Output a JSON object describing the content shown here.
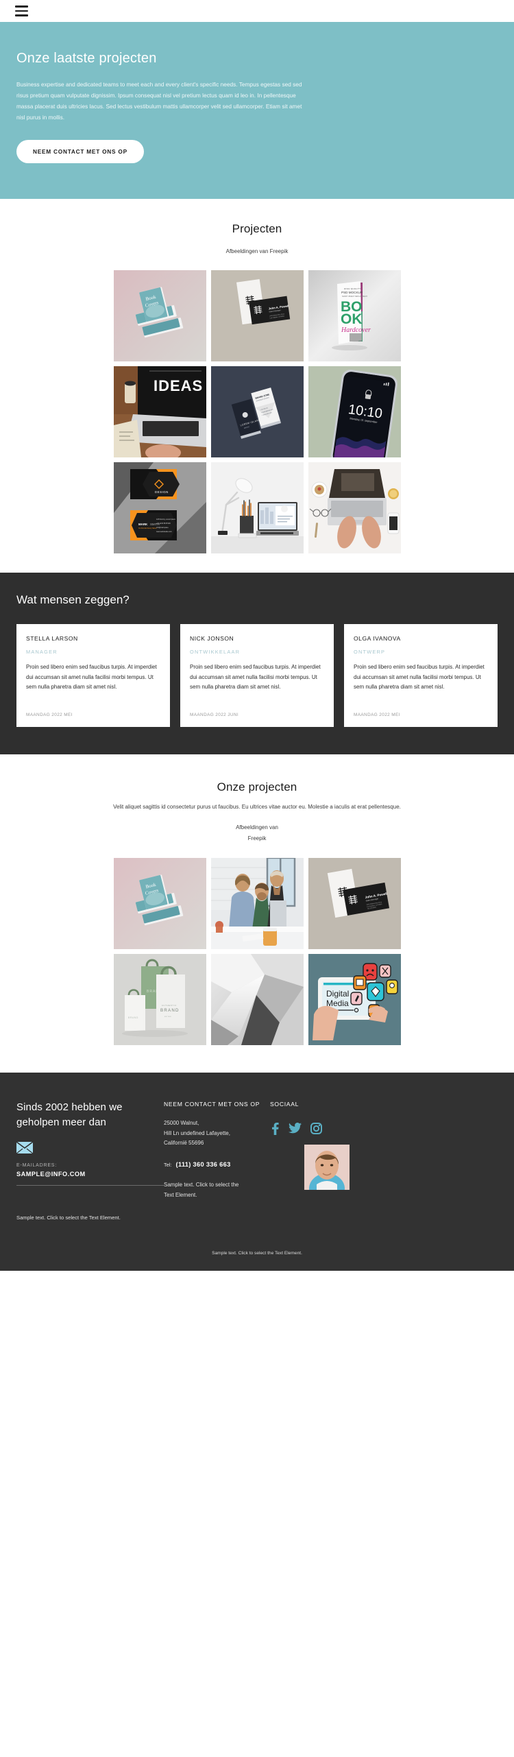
{
  "nav": {
    "menu_icon": "hamburger-icon"
  },
  "hero": {
    "title": "Onze laatste projecten",
    "body": "Business expertise and dedicated teams to meet each and every client's specific needs. Tempus egestas sed sed risus pretium quam vulputate dignissim. Ipsum consequat nisl vel pretium lectus quam id leo in. In pellentesque massa placerat duis ultricies lacus. Sed lectus vestibulum mattis ullamcorper velit sed ullamcorper. Etiam sit amet nisl purus in mollis.",
    "cta_label": "NEEM CONTACT MET ONS OP",
    "bg_color": "#7ebfc6"
  },
  "projects_section": {
    "title": "Projecten",
    "credit": "Afbeeldingen van Freepik",
    "items": [
      {
        "name": "book-covers-mockup"
      },
      {
        "name": "business-cards-white-black"
      },
      {
        "name": "book-hardcover-psd-mockup"
      },
      {
        "name": "laptop-ideas-desk"
      },
      {
        "name": "dark-business-cards"
      },
      {
        "name": "smartphone-lockscreen-1010"
      },
      {
        "name": "orange-black-business-cards"
      },
      {
        "name": "desk-lamp-laptop-workspace"
      },
      {
        "name": "hands-typing-laptop-flatlay"
      }
    ]
  },
  "testimonials": {
    "title": "Wat mensen zeggen?",
    "bg_color": "#2f2f2f",
    "cards": [
      {
        "name": "STELLA LARSON",
        "role": "MANAGER",
        "body": "Proin sed libero enim sed faucibus turpis. At imperdiet dui accumsan sit amet nulla facilisi morbi tempus. Ut sem nulla pharetra diam sit amet nisl.",
        "date": "MAANDAG 2022 MEI"
      },
      {
        "name": "NICK JONSON",
        "role": "ONTWIKKELAAR",
        "body": "Proin sed libero enim sed faucibus turpis. At imperdiet dui accumsan sit amet nulla facilisi morbi tempus. Ut sem nulla pharetra diam sit amet nisl.",
        "date": "MAANDAG 2022 JUNI"
      },
      {
        "name": "OLGA IVANOVA",
        "role": "ONTWERP",
        "body": "Proin sed libero enim sed faucibus turpis. At imperdiet dui accumsan sit amet nulla facilisi morbi tempus. Ut sem nulla pharetra diam sit amet nisl.",
        "date": "MAANDAG 2022 MEI"
      }
    ]
  },
  "our_projects_section": {
    "title": "Onze projecten",
    "subtitle": "Velit aliquet sagittis id consectetur purus ut faucibus. Eu ultrices vitae auctor eu. Molestie a iaculis at erat pellentesque.",
    "credit_line1": "Afbeeldingen van",
    "credit_line2": "Freepik",
    "items": [
      {
        "name": "book-covers-mockup-2"
      },
      {
        "name": "team-meeting-office"
      },
      {
        "name": "business-cards-john-powell"
      },
      {
        "name": "brand-paper-bags"
      },
      {
        "name": "abstract-paper-folds"
      },
      {
        "name": "digital-media-tablet"
      }
    ]
  },
  "footer": {
    "bg_color": "#323232",
    "heading": "Sinds 2002 hebben we geholpen meer dan",
    "mail_icon": "envelope-icon",
    "mail_icon_color": "#a6dcee",
    "email_label": "E-MAILADRES:",
    "email_value": "SAMPLE@INFO.COM",
    "contact": {
      "title": "NEEM CONTACT MET ONS OP",
      "address_line1": "25000 Walnut,",
      "address_line2": "Hill Ln undefined Lafayette,",
      "address_line3": "Californië 55696",
      "tel_label": "Tel:",
      "tel_value": "(111) 360 336 663"
    },
    "social": {
      "title": "SOCIAAL",
      "accent_color": "#5aafc4",
      "icons": [
        {
          "name": "facebook-icon"
        },
        {
          "name": "twitter-icon"
        },
        {
          "name": "instagram-icon"
        }
      ]
    },
    "sample_left": "Sample text. Click to select the Text Element.",
    "sample_mid": "Sample text. Click to select the Text Element.",
    "sample_bottom": "Sample text. Click to select the Text Element.",
    "avatar_name": "person-portrait-avatar"
  }
}
